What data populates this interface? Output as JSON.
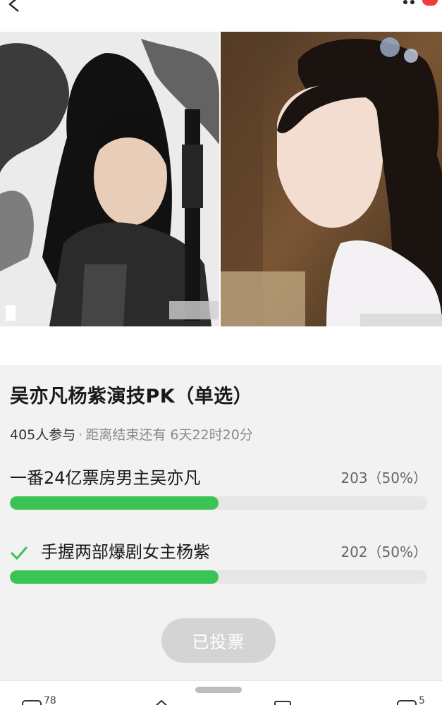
{
  "poll": {
    "title": "吴亦凡杨紫演技PK（单选）",
    "participants": "405人参与",
    "separator": "·",
    "ends_in": "距离结束还有 6天22时20分",
    "options": [
      {
        "label": "一番24亿票房男主吴亦凡",
        "count": "203（50%）",
        "share": 0.5,
        "selected": false
      },
      {
        "label": "手握两部爆剧女主杨紫",
        "count": "202（50%）",
        "share": 0.5,
        "selected": true
      }
    ],
    "voted_label": "已投票"
  },
  "bottom_bar": {
    "comment_count": "78",
    "like_count": "5"
  },
  "colors": {
    "accent_green": "#3bc456",
    "notification_red": "#f23c3c",
    "button_disabled": "#d4d4d4"
  },
  "icons": [
    "back-arrow-icon",
    "more-dots-icon",
    "check-icon",
    "comment-icon",
    "share-icon",
    "like-icon"
  ]
}
